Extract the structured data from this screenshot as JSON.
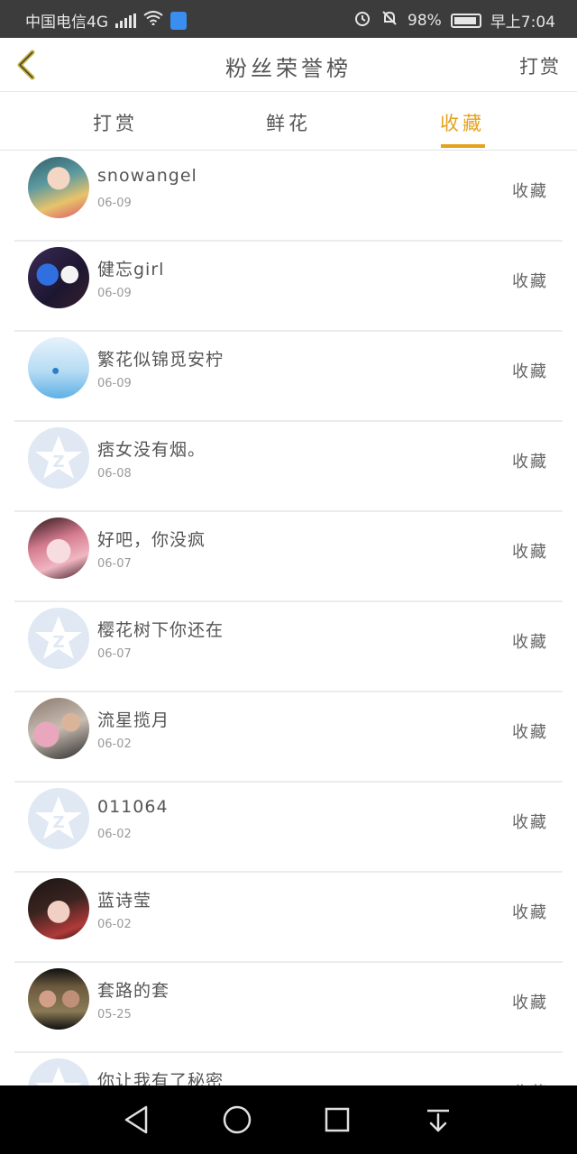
{
  "status_bar": {
    "carrier": "中国电信4G",
    "network": "4G",
    "battery": "98%",
    "time": "早上7:04"
  },
  "header": {
    "title": "粉丝荣誉榜",
    "right_label": "打赏"
  },
  "tabs": [
    {
      "label": "打赏",
      "active": false
    },
    {
      "label": "鲜花",
      "active": false
    },
    {
      "label": "收藏",
      "active": true
    }
  ],
  "accent_color": "#e5a21d",
  "list": [
    {
      "name": "snowangel",
      "date": "06-09",
      "action": "收藏",
      "avatar": "anime-girl-avatar"
    },
    {
      "name": "健忘girl",
      "date": "06-09",
      "action": "收藏",
      "avatar": "blue-star-avatar"
    },
    {
      "name": "繁花似锦觅安柠",
      "date": "06-09",
      "action": "收藏",
      "avatar": "water-drop-avatar"
    },
    {
      "name": "痞女没有烟。",
      "date": "06-08",
      "action": "收藏",
      "avatar": "default-qq-avatar"
    },
    {
      "name": "好吧，你没疯",
      "date": "06-07",
      "action": "收藏",
      "avatar": "pink-anime-avatar"
    },
    {
      "name": "樱花树下你还在",
      "date": "06-07",
      "action": "收藏",
      "avatar": "default-qq-avatar"
    },
    {
      "name": "流星揽月",
      "date": "06-02",
      "action": "收藏",
      "avatar": "couple-photo-avatar"
    },
    {
      "name": "011064",
      "date": "06-02",
      "action": "收藏",
      "avatar": "default-qq-avatar"
    },
    {
      "name": "蓝诗莹",
      "date": "06-02",
      "action": "收藏",
      "avatar": "woman-portrait-avatar"
    },
    {
      "name": "套路的套",
      "date": "05-25",
      "action": "收藏",
      "avatar": "movie-still-avatar"
    },
    {
      "name": "你让我有了秘密",
      "date": "",
      "action": "收藏",
      "avatar": "default-qq-avatar"
    }
  ]
}
